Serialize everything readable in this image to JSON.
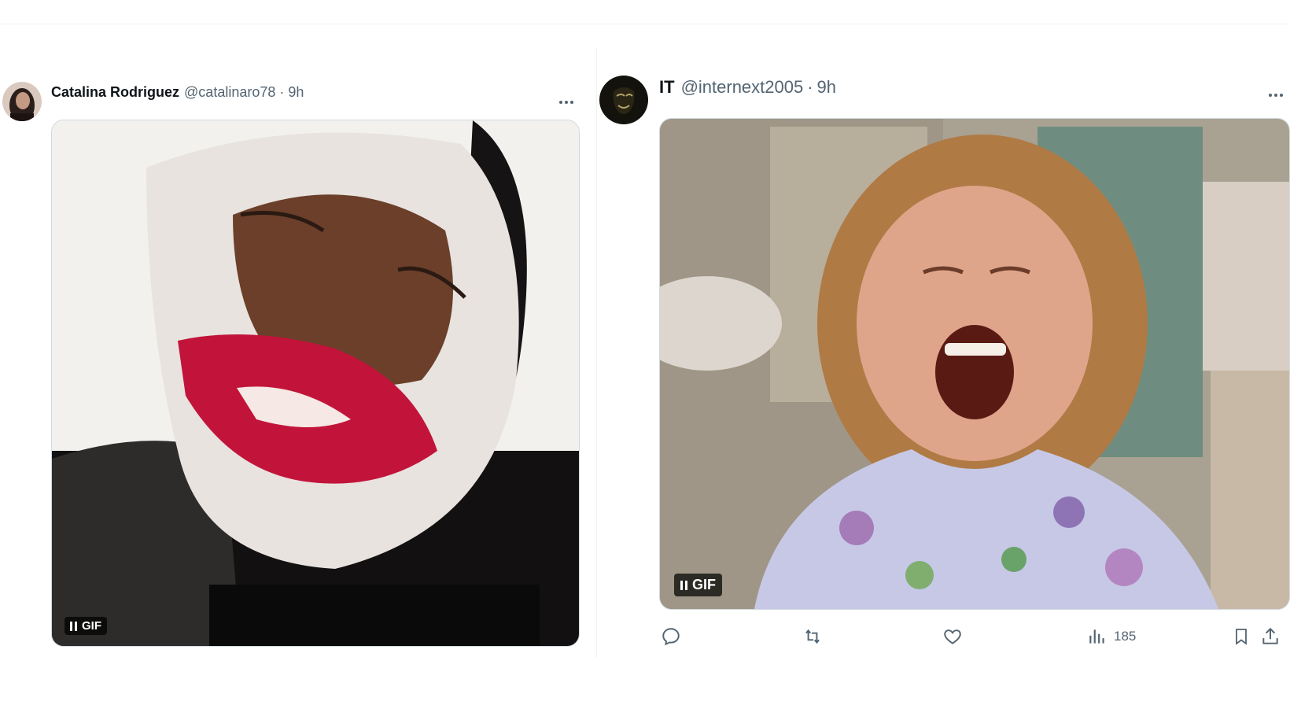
{
  "tweets": [
    {
      "author_name": "Catalina Rodriguez",
      "handle": "@catalinaro78",
      "separator": "·",
      "time": "9h",
      "media_badge": "GIF",
      "more_icon": "more-horizontal-icon"
    },
    {
      "author_name": "IT",
      "handle": "@internext2005",
      "separator": "·",
      "time": "9h",
      "media_badge": "GIF",
      "more_icon": "more-horizontal-icon",
      "actions": {
        "reply_icon": "reply-icon",
        "retweet_icon": "retweet-icon",
        "like_icon": "heart-icon",
        "views_icon": "views-chart-icon",
        "views_count": "185",
        "bookmark_icon": "bookmark-icon",
        "share_icon": "share-icon"
      }
    }
  ],
  "colors": {
    "text_primary": "#0f1419",
    "text_secondary": "#536471",
    "border": "#cfd9de"
  }
}
